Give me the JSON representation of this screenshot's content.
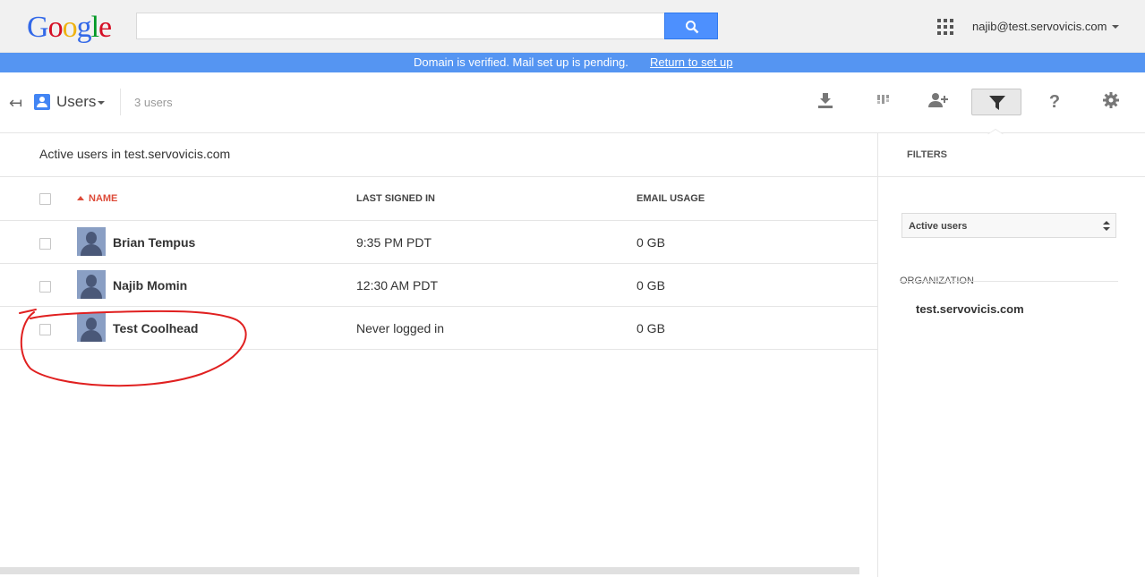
{
  "logo": [
    "G",
    "o",
    "o",
    "g",
    "l",
    "e"
  ],
  "search": {
    "value": "",
    "placeholder": ""
  },
  "account": {
    "email": "najib@test.servovicis.com"
  },
  "banner": {
    "message": "Domain is verified. Mail set up is pending.",
    "link": "Return to set up",
    "color": "#5595f2"
  },
  "toolbar": {
    "back_icon": "back-arrow-icon",
    "section": "Users",
    "count": "3 users",
    "tools": [
      "download-icon",
      "columns-icon",
      "add-user-icon",
      "filter-icon",
      "help-icon",
      "settings-icon"
    ]
  },
  "main": {
    "heading": "Active users in test.servovicis.com",
    "columns": {
      "name": "NAME",
      "last_signed_in": "LAST SIGNED IN",
      "email_usage": "EMAIL USAGE"
    },
    "rows": [
      {
        "name": "Brian Tempus",
        "last_signed_in": "9:35 PM PDT",
        "email_usage": "0 GB"
      },
      {
        "name": "Najib Momin",
        "last_signed_in": "12:30 AM PDT",
        "email_usage": "0 GB"
      },
      {
        "name": "Test Coolhead",
        "last_signed_in": "Never logged in",
        "email_usage": "0 GB"
      }
    ]
  },
  "filters": {
    "title": "FILTERS",
    "selected": "Active users",
    "org_title": "ORGANIZATION",
    "org_value": "test.servovicis.com"
  },
  "annotation": {
    "color": "#e02020"
  }
}
